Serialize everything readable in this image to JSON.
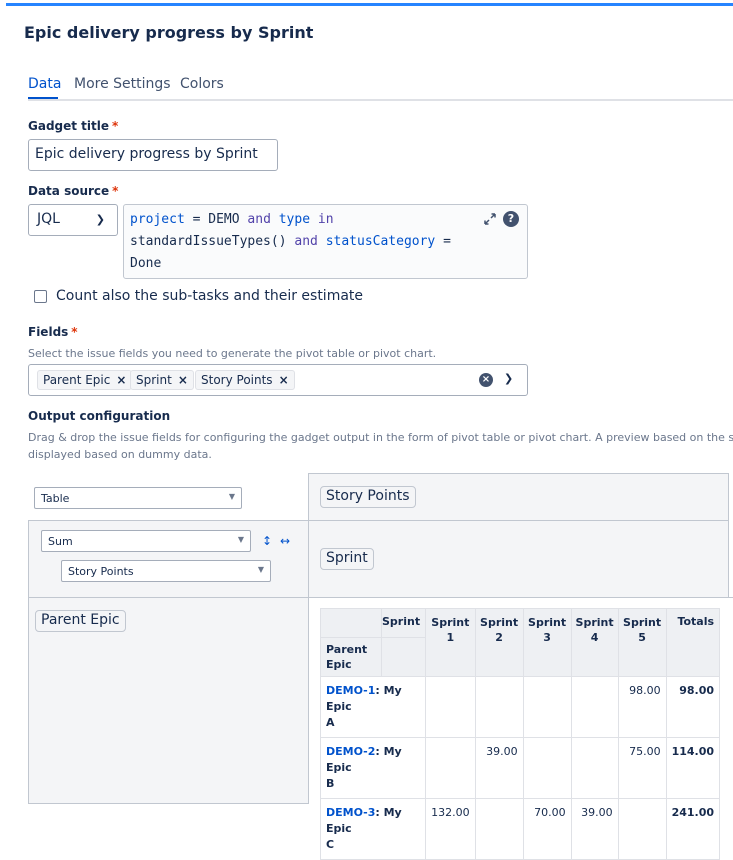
{
  "header": {
    "title": "Epic delivery progress by Sprint"
  },
  "tabs": [
    {
      "label": "Data",
      "active": true
    },
    {
      "label": "More Settings",
      "active": false
    },
    {
      "label": "Colors",
      "active": false
    }
  ],
  "gadget_title": {
    "label": "Gadget title",
    "required_mark": "*",
    "value": "Epic delivery progress by Sprint"
  },
  "data_source": {
    "label": "Data source",
    "required_mark": "*",
    "type_select": "JQL",
    "jql": {
      "tok1": "project",
      "tok2": " = DEMO ",
      "tok3": "and",
      "tok4": " ",
      "tok5": "type",
      "tok6": " ",
      "tok7": "in",
      "tok8": "standardIssueTypes() ",
      "tok9": "and",
      "tok10": " ",
      "tok11": "statusCategory",
      "tok12": " =",
      "tok13": "Done"
    }
  },
  "subtasks": {
    "label": "Count also the sub-tasks and their estimate",
    "checked": false
  },
  "fields": {
    "label": "Fields",
    "required_mark": "*",
    "help": "Select the issue fields you need to generate the pivot table or pivot chart.",
    "chips": [
      "Parent Epic",
      "Sprint",
      "Story Points"
    ]
  },
  "output": {
    "label": "Output configuration",
    "help_line1": "Drag & drop the issue fields for configuring the gadget output in the form of pivot table or pivot chart. A preview based on the setti",
    "help_line2": "displayed based on dummy data.",
    "renderer": "Table",
    "aggregator": "Sum",
    "aggregator_field": "Story Points",
    "col_value_pill": "Story Points",
    "col_pill": "Sprint",
    "row_pill": "Parent Epic"
  },
  "pivot": {
    "col_attr": "Sprint",
    "row_attr_line1": "Parent",
    "row_attr_line2": "Epic",
    "col_headers": [
      {
        "l1": "Sprint",
        "l2": "1"
      },
      {
        "l1": "Sprint",
        "l2": "2"
      },
      {
        "l1": "Sprint",
        "l2": "3"
      },
      {
        "l1": "Sprint",
        "l2": "4"
      },
      {
        "l1": "Sprint",
        "l2": "5"
      }
    ],
    "totals_label": "Totals",
    "rows": [
      {
        "key": "DEMO-1",
        "name1": ": My Epic",
        "name2": "A",
        "values": [
          "",
          "",
          "",
          "",
          "98.00"
        ],
        "total": "98.00"
      },
      {
        "key": "DEMO-2",
        "name1": ": My Epic",
        "name2": "B",
        "values": [
          "",
          "39.00",
          "",
          "",
          "75.00"
        ],
        "total": "114.00"
      },
      {
        "key": "DEMO-3",
        "name1": ": My Epic",
        "name2": "C",
        "values": [
          "132.00",
          "",
          "70.00",
          "39.00",
          ""
        ],
        "total": "241.00"
      }
    ]
  },
  "colors": {
    "accent": "#0052cc",
    "topbar": "#2684ff",
    "required": "#de350b"
  }
}
